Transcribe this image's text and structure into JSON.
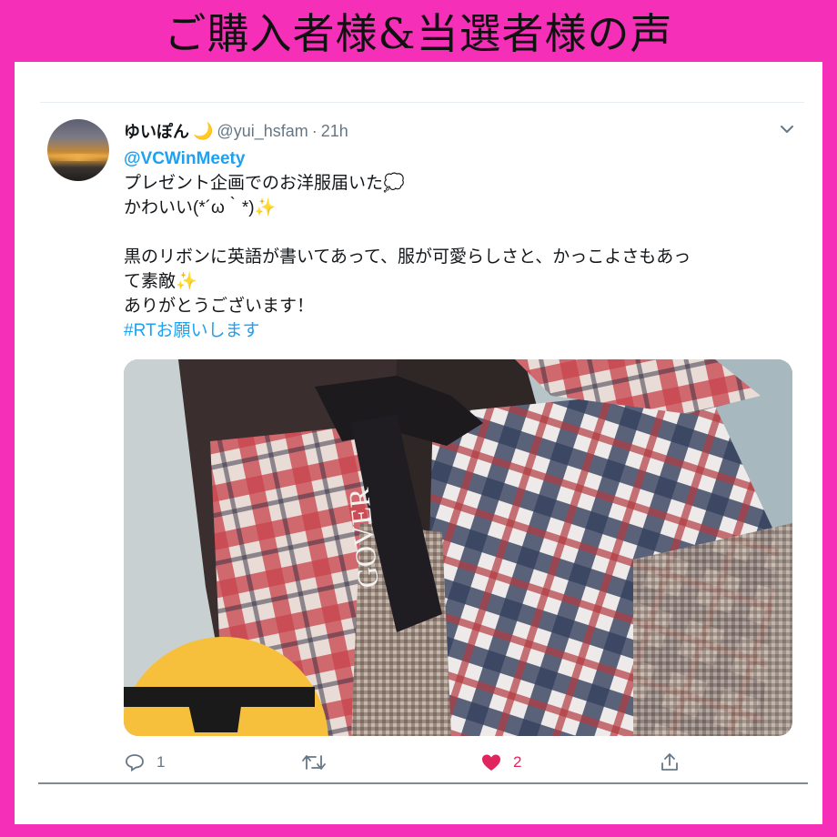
{
  "banner": {
    "title": "ご購入者様&当選者様の声"
  },
  "tweet": {
    "display_name": "ゆいぽん",
    "name_emoji": "🌙",
    "handle": "@yui_hsfam",
    "separator": "·",
    "time": "21h",
    "mention": "@VCWinMeety",
    "line1": "プレゼント企画でのお洋服届いた",
    "line1_emoji": "💭",
    "line2": "かわいい(*´ω｀*)",
    "line2_emoji": "✨",
    "line3": "黒のリボンに英語が書いてあって、服が可愛らしさと、かっこよさもあっ",
    "line4": "て素敵",
    "line4_emoji": "✨",
    "line5": "ありがとうございます！",
    "hashtag": "#RTお願いします",
    "ribbon_text": "GOVER",
    "reply_count": "1",
    "like_count": "2",
    "icons": [
      "chevron-down-icon",
      "reply-icon",
      "retweet-icon",
      "heart-icon",
      "share-icon"
    ],
    "colors": {
      "link": "#1da1f2",
      "like": "#e0245e",
      "muted": "#657786",
      "frame": "#f52fb8"
    }
  }
}
